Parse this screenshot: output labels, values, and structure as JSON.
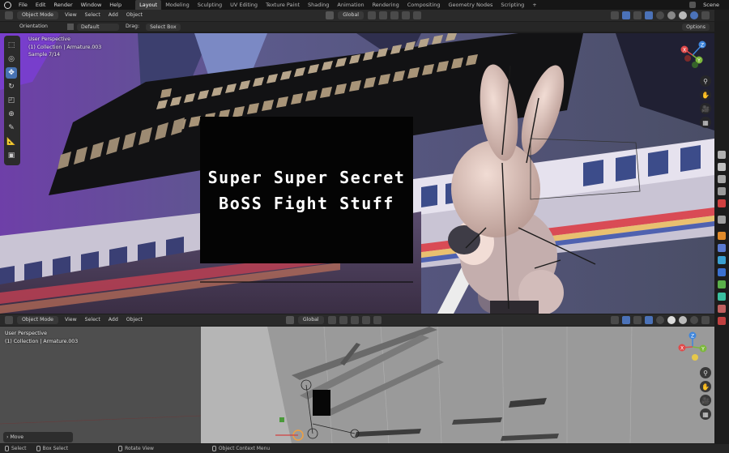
{
  "menubar": {
    "menus": [
      "File",
      "Edit",
      "Render",
      "Window",
      "Help"
    ],
    "workspaces": [
      "Layout",
      "Modeling",
      "Sculpting",
      "UV Editing",
      "Texture Paint",
      "Shading",
      "Animation",
      "Rendering",
      "Compositing",
      "Geometry Nodes",
      "Scripting"
    ],
    "active_workspace": "Layout",
    "add_tab": "+",
    "scene_label": "Scene"
  },
  "top_header": {
    "mode": "Object Mode",
    "menus": [
      "View",
      "Select",
      "Add",
      "Object"
    ],
    "transform_orientation": "Global"
  },
  "top_subheader": {
    "orientation_label": "Orientation",
    "orientation_value": "Default",
    "drag_label": "Drag:",
    "drag_value": "Select Box",
    "options_label": "Options"
  },
  "top_viewport": {
    "overlay_lines": [
      "User Perspective",
      "(1) Collection | Armature.003",
      "Sample 7/14"
    ],
    "slide_text": [
      "Super Super Secret",
      "BoSS Fight Stuff"
    ],
    "gizmo": {
      "x": "X",
      "y": "Y",
      "z": "Z"
    }
  },
  "bottom_header": {
    "mode": "Object Mode",
    "menus": [
      "View",
      "Select",
      "Add",
      "Object"
    ],
    "transform_orientation": "Global"
  },
  "bottom_viewport": {
    "overlay_lines": [
      "User Perspective",
      "(1) Collection | Armature.003"
    ],
    "gizmo": {
      "x": "X",
      "y": "Y",
      "z": "Z"
    },
    "last_operator": "Move"
  },
  "statusbar": {
    "items": [
      "Select",
      "Box Select",
      "Rotate View",
      "Object Context Menu"
    ]
  },
  "colors": {
    "active_blue": "#4772b3",
    "gizmo_x": "#e04a4a",
    "gizmo_y": "#7cb83c",
    "gizmo_z": "#3f86dc"
  }
}
